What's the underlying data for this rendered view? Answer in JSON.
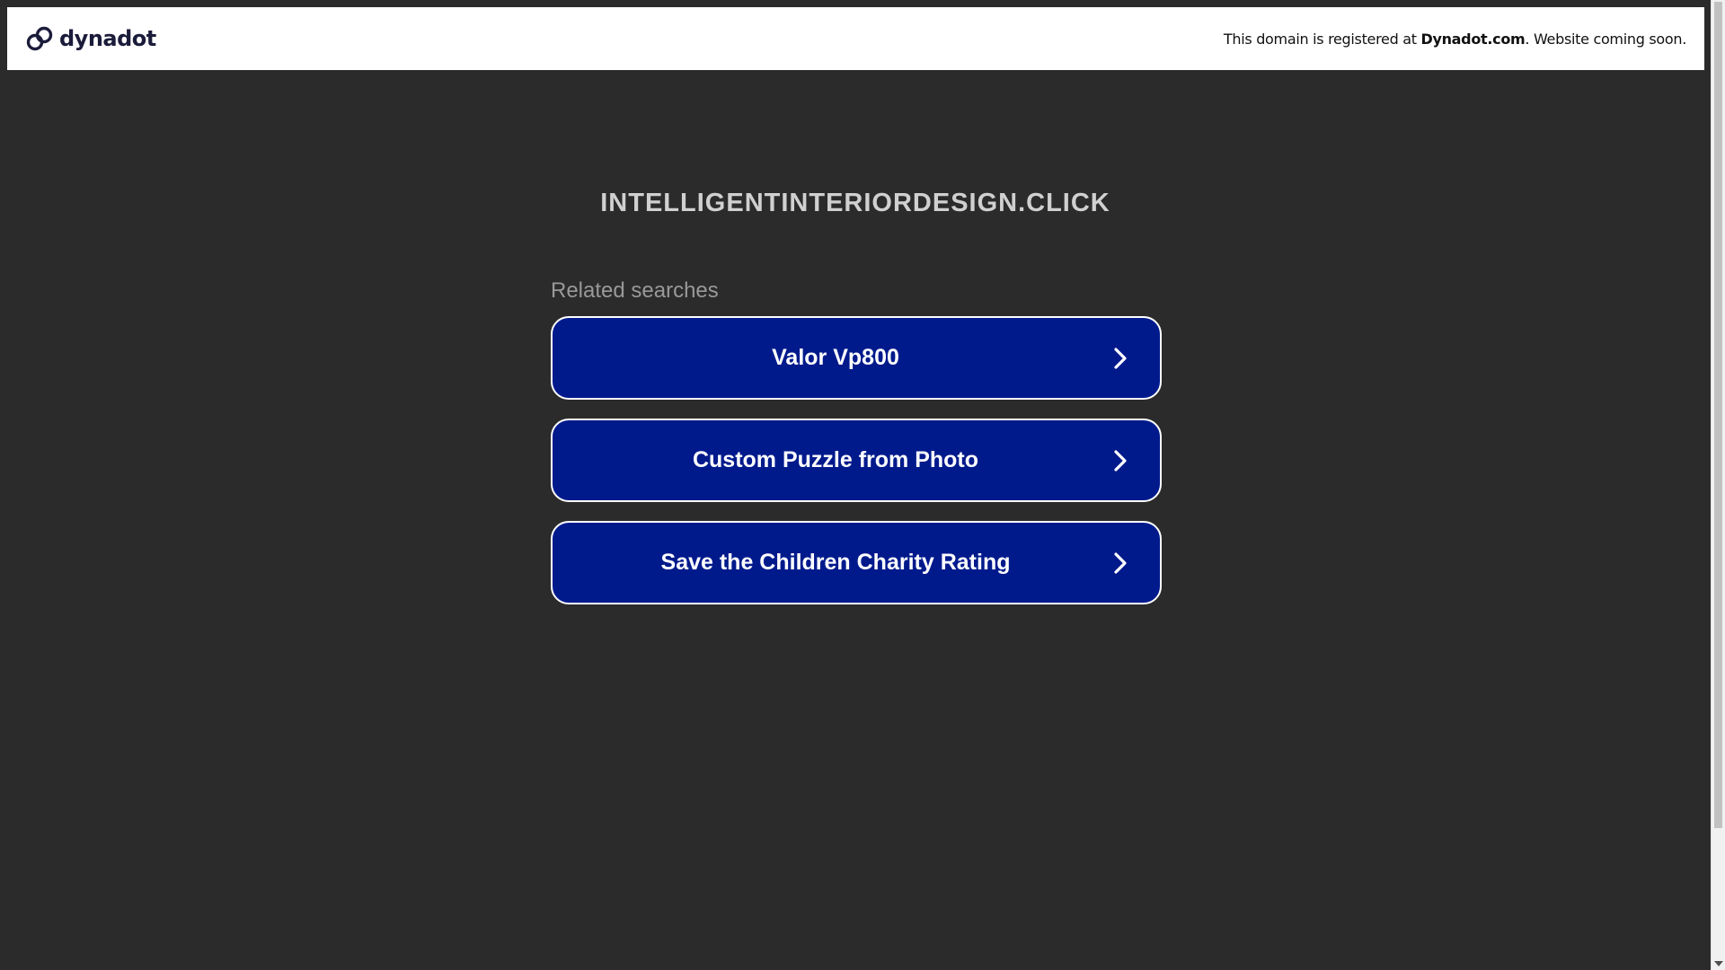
{
  "header": {
    "logo_text": "dynadot",
    "note_prefix": "This domain is registered at ",
    "note_brand": "Dynadot.com",
    "note_suffix": ". Website coming soon."
  },
  "main": {
    "domain": "INTELLIGENTINTERIORDESIGN.CLICK",
    "related_label": "Related searches",
    "results": [
      {
        "label": "Valor Vp800"
      },
      {
        "label": "Custom Puzzle from Photo"
      },
      {
        "label": "Save the Children Charity Rating"
      }
    ]
  },
  "icons": {
    "logo": "dynadot-logo-icon",
    "chevron": "chevron-right-icon"
  },
  "colors": {
    "background": "#2b2b2b",
    "button": "#001a8c",
    "title": "#d0d0d0",
    "related": "#999999"
  }
}
